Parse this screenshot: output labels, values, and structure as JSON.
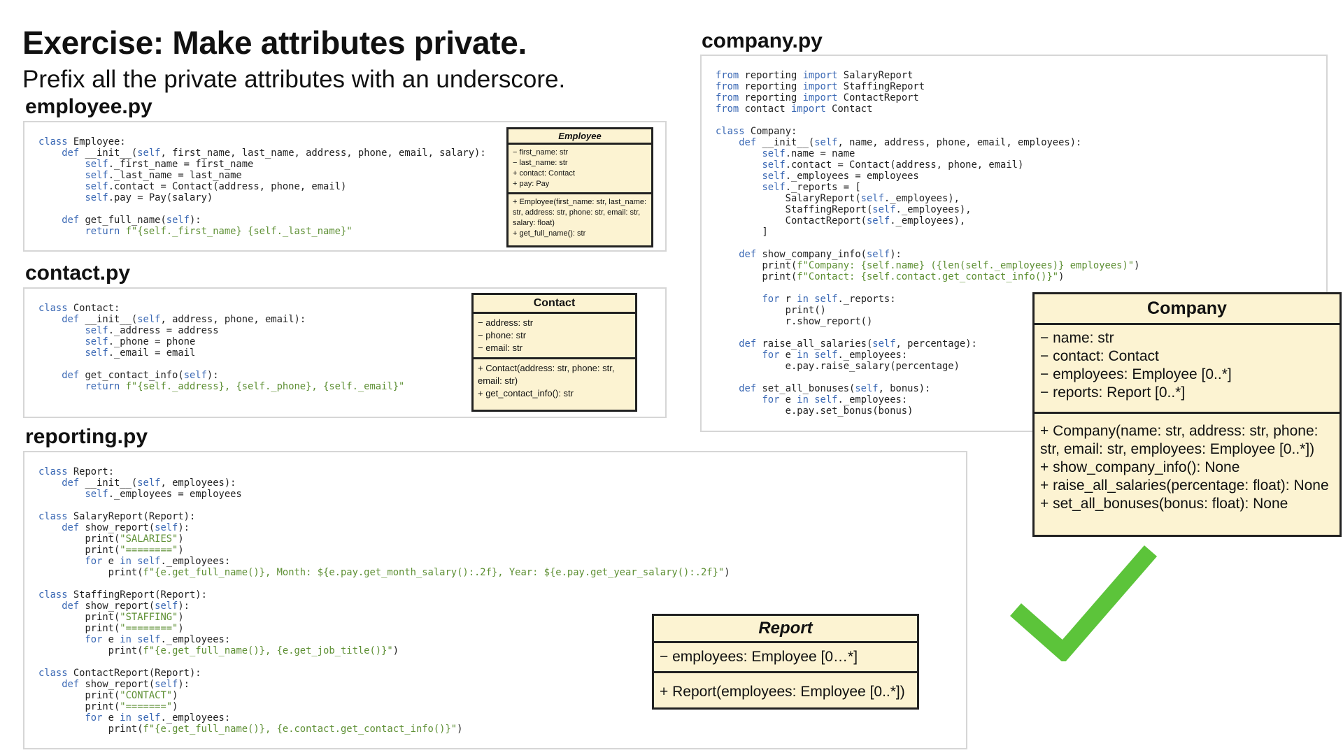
{
  "title": "Exercise: Make attributes private.",
  "subtitle": "Prefix all the private attributes with an underscore.",
  "files": {
    "employee": "employee.py",
    "contact": "contact.py",
    "reporting": "reporting.py",
    "company": "company.py"
  },
  "code": {
    "employee": [
      "class Employee:",
      "    def __init__(self, first_name, last_name, address, phone, email, salary):",
      "        self._first_name = first_name",
      "        self._last_name = last_name",
      "        self.contact = Contact(address, phone, email)",
      "        self.pay = Pay(salary)",
      "",
      "    def get_full_name(self):",
      "        return f\"{self._first_name} {self._last_name}\""
    ],
    "contact": [
      "class Contact:",
      "    def __init__(self, address, phone, email):",
      "        self._address = address",
      "        self._phone = phone",
      "        self._email = email",
      "",
      "    def get_contact_info(self):",
      "        return f\"{self._address}, {self._phone}, {self._email}\""
    ],
    "reporting": [
      "class Report:",
      "    def __init__(self, employees):",
      "        self._employees = employees",
      "",
      "class SalaryReport(Report):",
      "    def show_report(self):",
      "        print(\"SALARIES\")",
      "        print(\"========\")",
      "        for e in self._employees:",
      "            print(f\"{e.get_full_name()}, Month: ${e.pay.get_month_salary():.2f}, Year: ${e.pay.get_year_salary():.2f}\")",
      "",
      "class StaffingReport(Report):",
      "    def show_report(self):",
      "        print(\"STAFFING\")",
      "        print(\"========\")",
      "        for e in self._employees:",
      "            print(f\"{e.get_full_name()}, {e.get_job_title()}\")",
      "",
      "class ContactReport(Report):",
      "    def show_report(self):",
      "        print(\"CONTACT\")",
      "        print(\"=======\")",
      "        for e in self._employees:",
      "            print(f\"{e.get_full_name()}, {e.contact.get_contact_info()}\")"
    ],
    "company": [
      "from reporting import SalaryReport",
      "from reporting import StaffingReport",
      "from reporting import ContactReport",
      "from contact import Contact",
      "",
      "class Company:",
      "    def __init__(self, name, address, phone, email, employees):",
      "        self.name = name",
      "        self.contact = Contact(address, phone, email)",
      "        self._employees = employees",
      "        self._reports = [",
      "            SalaryReport(self._employees),",
      "            StaffingReport(self._employees),",
      "            ContactReport(self._employees),",
      "        ]",
      "",
      "    def show_company_info(self):",
      "        print(f\"Company: {self.name} ({len(self._employees)} employees)\")",
      "        print(f\"Contact: {self.contact.get_contact_info()}\")",
      "",
      "        for r in self._reports:",
      "            print()",
      "            r.show_report()",
      "",
      "    def raise_all_salaries(self, percentage):",
      "        for e in self._employees:",
      "            e.pay.raise_salary(percentage)",
      "",
      "    def set_all_bonuses(self, bonus):",
      "        for e in self._employees:",
      "            e.pay.set_bonus(bonus)"
    ]
  },
  "uml": {
    "employee": {
      "name": "Employee",
      "attributes": [
        "−  first_name: str",
        "−  last_name: str",
        "+  contact: Contact",
        "+  pay: Pay"
      ],
      "methods": [
        "+  Employee(first_name: str, last_name: str, address: str, phone: str, email: str,  salary: float)",
        "+  get_full_name(): str"
      ]
    },
    "contact": {
      "name": "Contact",
      "attributes": [
        "−  address: str",
        "−  phone: str",
        "−  email: str"
      ],
      "methods": [
        "+  Contact(address: str, phone: str, email: str)",
        "+  get_contact_info(): str"
      ]
    },
    "report": {
      "name": "Report",
      "attributes": [
        "−  employees: Employee [0…*]"
      ],
      "methods": [
        "+  Report(employees: Employee [0..*])"
      ]
    },
    "company": {
      "name": "Company",
      "attributes": [
        "−  name: str",
        "−  contact: Contact",
        "−  employees: Employee [0..*]",
        "−  reports: Report [0..*]"
      ],
      "methods": [
        "+  Company(name: str, address: str, phone: str, email: str, employees: Employee [0..*])",
        "+  show_company_info(): None",
        "+  raise_all_salaries(percentage: float): None",
        "+  set_all_bonuses(bonus: float): None"
      ]
    }
  },
  "icons": {
    "check": "checkmark-icon"
  },
  "colors": {
    "keyword": "#3a68b4",
    "string": "#5d8f33",
    "uml_fill": "#fcf3d2",
    "check": "#5cc43a"
  }
}
